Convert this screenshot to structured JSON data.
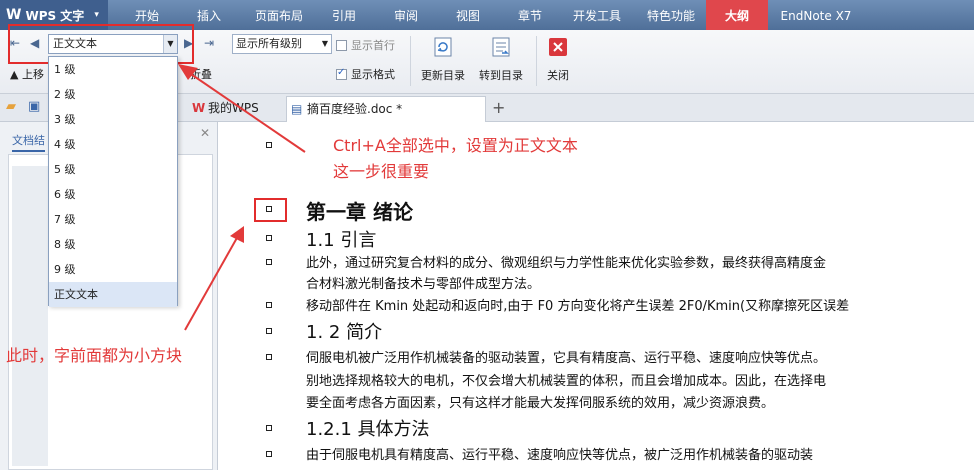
{
  "app": {
    "logo_text": "WPS 文字"
  },
  "menu_tabs": [
    "开始",
    "插入",
    "页面布局",
    "引用",
    "审阅",
    "视图",
    "章节",
    "开发工具",
    "特色功能",
    "大纲",
    "EndNote X7"
  ],
  "ribbon": {
    "level_value": "正文文本",
    "show_levels_value": "显示所有级别",
    "show_first_line": "显示首行",
    "show_format": "显示格式",
    "update_toc": "更新目录",
    "goto_toc": "转到目录",
    "close": "关闭",
    "move_up": "上移",
    "fold": "折叠"
  },
  "doc_tabs": {
    "home": "我的WPS",
    "doc": "摘百度经验.doc *"
  },
  "left_panel": {
    "tab": "文档结"
  },
  "level_options": [
    "1 级",
    "2 级",
    "3 级",
    "4 级",
    "5 级",
    "6 级",
    "7 级",
    "8 级",
    "9 级",
    "正文文本"
  ],
  "document_lines": [
    {
      "style": "body",
      "text": ""
    },
    {
      "style": "h1",
      "text": "第一章  绪论"
    },
    {
      "style": "h2",
      "text": "1.1 引言"
    },
    {
      "style": "body",
      "text": "此外，通过研究复合材料的成分、微观组织与力学性能来优化实验参数，最终获得高精度金"
    },
    {
      "style": "body",
      "text": "合材料激光制备技术与零部件成型方法。"
    },
    {
      "style": "body",
      "text": "移动部件在 Kmin 处起动和返向时,由于 F0 方向变化将产生误差 2F0/Kmin(又称摩擦死区误差"
    },
    {
      "style": "h2",
      "text": "1. 2  简介"
    },
    {
      "style": "body",
      "text": "伺服电机被广泛用作机械装备的驱动装置，它具有精度高、运行平稳、速度响应快等优点。"
    },
    {
      "style": "body",
      "text": "别地选择规格较大的电机，不仅会增大机械装置的体积，而且会增加成本。因此，在选择电"
    },
    {
      "style": "body",
      "text": "要全面考虑各方面因素，只有这样才能最大发挥伺服系统的效用，减少资源浪费。"
    },
    {
      "style": "h3",
      "text": "1.2.1  具体方法"
    },
    {
      "style": "body",
      "text": "由于伺服电机具有精度高、运行平稳、速度响应快等优点，被广泛用作机械装备的驱动装"
    }
  ],
  "annotations": {
    "top_line1": "Ctrl+A全部选中，设置为正文文本",
    "top_line2": "这一步很重要",
    "left": "此时，字前面都为小方块"
  },
  "colors": {
    "annotation": "#e23a3a",
    "menu_bg": "#5a7aa6",
    "outline_tab": "#e0474c"
  }
}
